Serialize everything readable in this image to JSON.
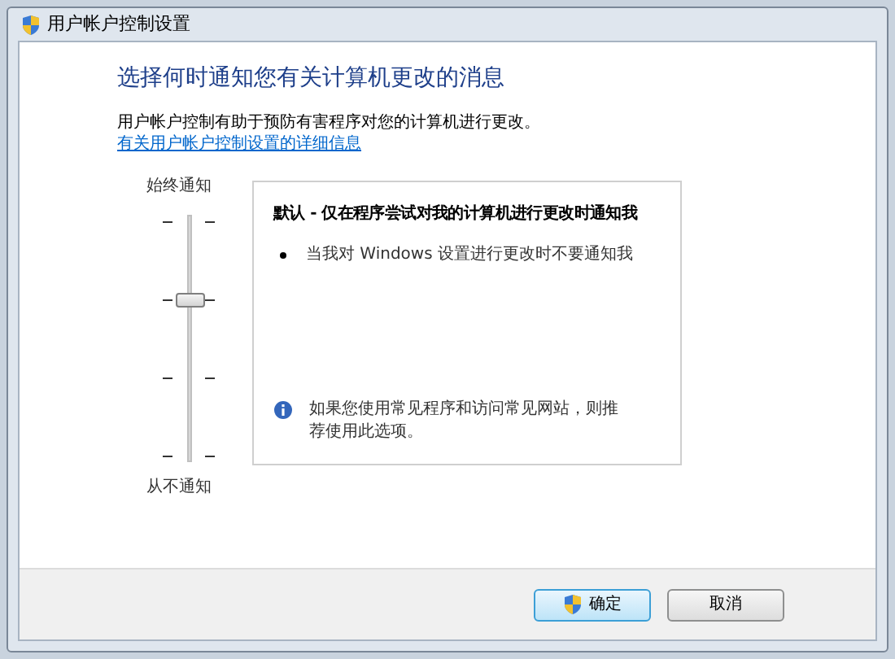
{
  "window": {
    "title": "用户帐户控制设置"
  },
  "heading": "选择何时通知您有关计算机更改的消息",
  "description": "用户帐户控制有助于预防有害程序对您的计算机进行更改。",
  "link": "有关用户帐户控制设置的详细信息",
  "slider": {
    "top_label": "始终通知",
    "bottom_label": "从不通知",
    "level": 0.667
  },
  "panel": {
    "title": "默认 - 仅在程序尝试对我的计算机进行更改时通知我",
    "bullets": [
      "当我对 Windows 设置进行更改时不要通知我"
    ],
    "info": "如果您使用常见程序和访问常见网站，则推荐使用此选项。"
  },
  "buttons": [
    {
      "label": "确定",
      "kind": "shield",
      "default": true
    },
    {
      "label": "取消",
      "kind": "plain",
      "default": false
    }
  ]
}
